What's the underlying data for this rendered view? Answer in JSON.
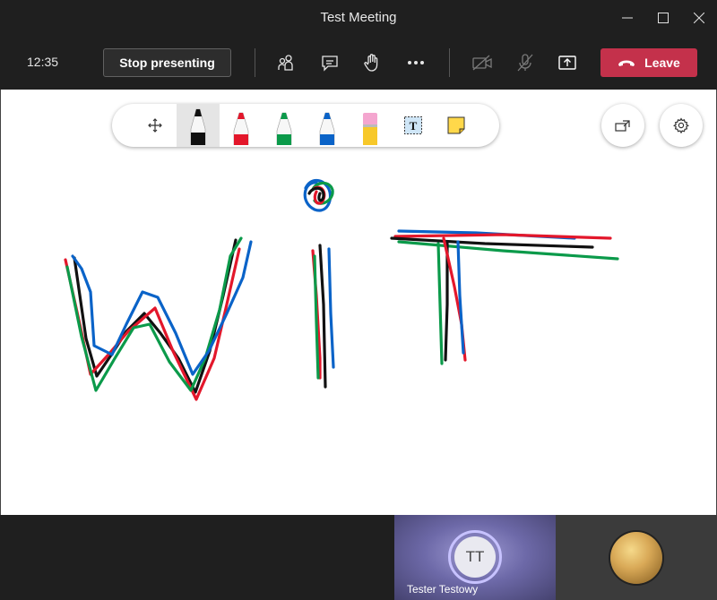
{
  "window": {
    "title": "Test Meeting",
    "controls": [
      "minimize-icon",
      "maximize-icon",
      "close-icon"
    ]
  },
  "meeting_bar": {
    "time": "12:35",
    "stop_presenting_label": "Stop presenting",
    "icons": [
      "people-icon",
      "chat-icon",
      "raise-hand-icon",
      "more-icon",
      "camera-off-icon",
      "mic-off-icon",
      "share-tray-icon"
    ],
    "leave_label": "Leave",
    "leave_color": "#c4314b"
  },
  "whiteboard": {
    "tools": [
      "move-icon",
      "pen-black-icon",
      "pen-red-icon",
      "pen-green-icon",
      "pen-blue-icon",
      "highlighter-icon",
      "text-box-icon",
      "sticky-note-icon"
    ],
    "selected_tool": "pen-black-icon",
    "ink_colors": {
      "black": "#111111",
      "red": "#e3172b",
      "green": "#0b9a4a",
      "blue": "#0a63c8"
    },
    "side_buttons": [
      "open-external-icon",
      "settings-icon"
    ]
  },
  "participants": [
    {
      "initials": "TT",
      "name": "Tester Testowy"
    },
    {
      "image": "moon-avatar"
    }
  ]
}
